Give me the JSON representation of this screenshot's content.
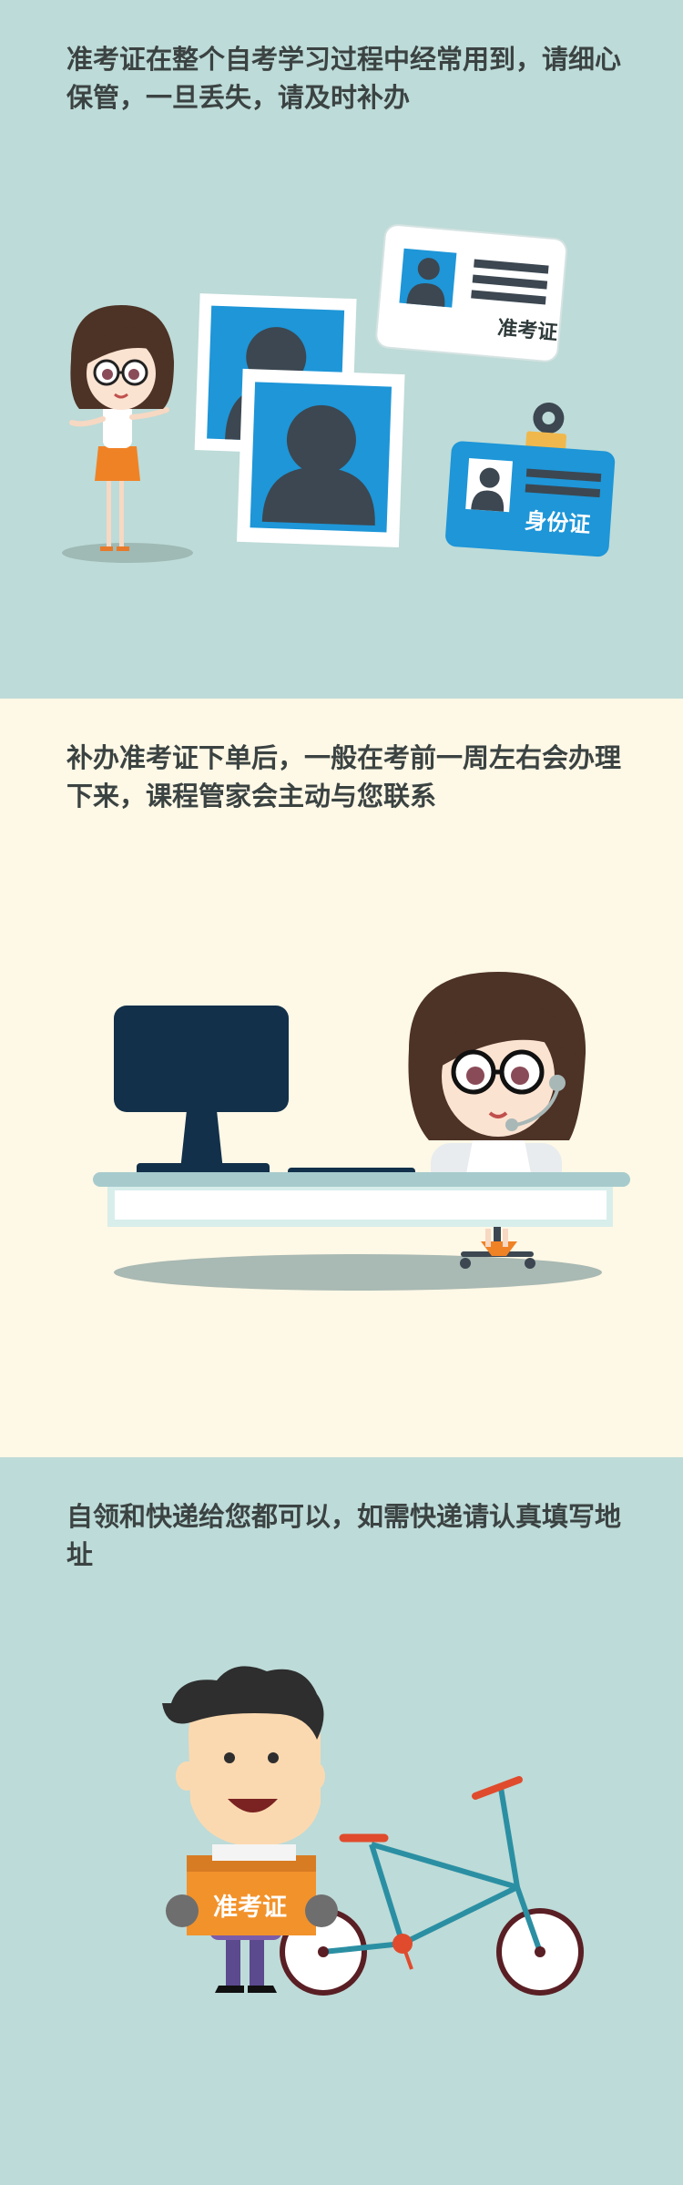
{
  "panels": [
    {
      "caption": "准考证在整个自考学习过程中经常用到，请细心保管，一旦丢失，请及时补办",
      "ticket_card_label": "准考证",
      "id_card_label": "身份证"
    },
    {
      "caption": "补办准考证下单后，一般在考前一周左右会办理下来，课程管家会主动与您联系"
    },
    {
      "caption": "自领和快递给您都可以，如需快递请认真填写地址",
      "box_label": "准考证"
    }
  ],
  "colors": {
    "teal_bg": "#bddbd8",
    "cream_bg": "#fef8e6",
    "photo_blue": "#1e96d8",
    "text_dark": "#3b4342",
    "orange": "#f2922b"
  }
}
